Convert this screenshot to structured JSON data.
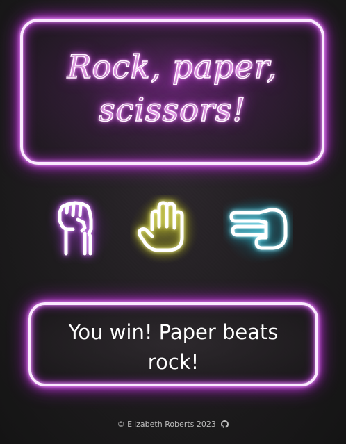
{
  "title": "Rock, paper, scissors!",
  "choices": [
    {
      "id": "rock",
      "icon": "rock-hand-icon",
      "glow_color": "#8a35b8"
    },
    {
      "id": "paper",
      "icon": "paper-hand-icon",
      "glow_color": "#d6d62e"
    },
    {
      "id": "scissors",
      "icon": "scissors-hand-icon",
      "glow_color": "#2fb3c6"
    }
  ],
  "result": "You win! Paper beats rock!",
  "footer": {
    "text": "© Elizabeth Roberts 2023",
    "icon": "github-icon"
  },
  "colors": {
    "neon_pink": "#d04ae8",
    "neon_white": "#fbe9ff",
    "background": "#181818"
  }
}
